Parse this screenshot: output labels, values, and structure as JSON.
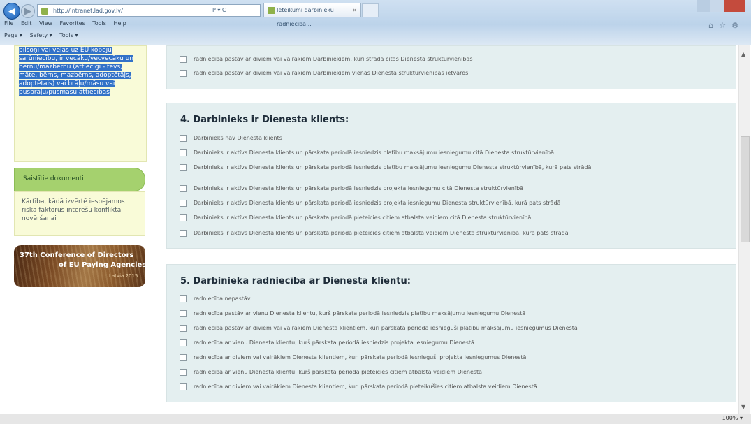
{
  "browser": {
    "address": "http://intranet.lad.gov.lv/",
    "address_controls": "P ▾ C",
    "tab_title": "Ieteikumi darbinieku radniecība...",
    "menu": [
      "File",
      "Edit",
      "View",
      "Favorites",
      "Tools",
      "Help"
    ],
    "command_bar": [
      "Page ▾",
      "Safety ▾",
      "Tools ▾"
    ],
    "status_zoom": "100% ▾"
  },
  "sidebar": {
    "selected_text": "pilsoņi vai vēlās uz EU kopēju sarūniecību, ir vecāku/vecvecāku un bērnu/mazbērnu (attiecīgi - tēvs, māte, bērns, mazbērns, adoptētājs, adoptētais) vai brāļu/māsu vai pusbrāļu/pusmāsu attiecībās",
    "related_tab_label": "Saistītie dokumenti",
    "related_text": "Kārtība, kādā izvērtē iespējamos riska faktorus interešu konflikta novēršanai",
    "banner": {
      "line1": "37th Conference of Directors",
      "line2": "of EU Paying Agencies",
      "line3": "Latvia 2015"
    }
  },
  "top_panel": {
    "options": [
      "radniecība pastāv ar diviem vai vairākiem Darbiniekiem, kuri strādā citās Dienesta struktūrvienībās",
      "radniecība pastāv ar diviem vai vairākiem Darbiniekiem vienas Dienesta struktūrvienības ietvaros"
    ]
  },
  "section4": {
    "title": "4. Darbinieks ir Dienesta klients:",
    "options": [
      "Darbinieks nav Dienesta klients",
      "Darbinieks ir aktīvs Dienesta klients un pārskata periodā iesniedzis platību maksājumu iesniegumu citā Dienesta struktūrvienībā",
      "Darbinieks ir aktīvs Dienesta klients un pārskata periodā iesniedzis platību maksājumu iesniegumu Dienesta struktūrvienībā, kurā pats strādā",
      "Darbinieks ir aktīvs Dienesta klients un pārskata periodā iesniedzis projekta iesniegumu citā Dienesta struktūrvienībā",
      "Darbinieks ir aktīvs Dienesta klients un pārskata periodā iesniedzis projekta iesniegumu Dienesta struktūrvienībā, kurā pats strādā",
      "Darbinieks ir aktīvs Dienesta klients un pārskata periodā pieteicies citiem atbalsta veidiem citā Dienesta struktūrvienībā",
      "Darbinieks ir aktīvs Dienesta klients un pārskata periodā pieteicies citiem atbalsta veidiem Dienesta struktūrvienībā, kurā pats strādā"
    ]
  },
  "section5": {
    "title": "5. Darbinieka radniecība ar Dienesta klientu:",
    "options": [
      "radniecība nepastāv",
      "radniecība pastāv ar vienu Dienesta klientu, kurš pārskata periodā iesniedzis platību maksājumu iesniegumu Dienestā",
      "radniecība pastāv ar diviem vai vairākiem Dienesta klientiem, kuri pārskata periodā iesnieguši platību maksājumu iesniegumus Dienestā",
      "radniecība ar vienu Dienesta klientu, kurš pārskata periodā iesniedzis projekta iesniegumu Dienestā",
      "radniecība ar diviem vai vairākiem Dienesta klientiem, kuri pārskata periodā iesnieguši projekta iesniegumus Dienestā",
      "radniecība ar vienu Dienesta klientu, kurš pārskata periodā pieteicies citiem atbalsta veidiem Dienestā",
      "radniecība ar diviem vai vairākiem Dienesta klientiem, kuri pārskata periodā pieteikušies citiem atbalsta veidiem Dienestā"
    ]
  }
}
